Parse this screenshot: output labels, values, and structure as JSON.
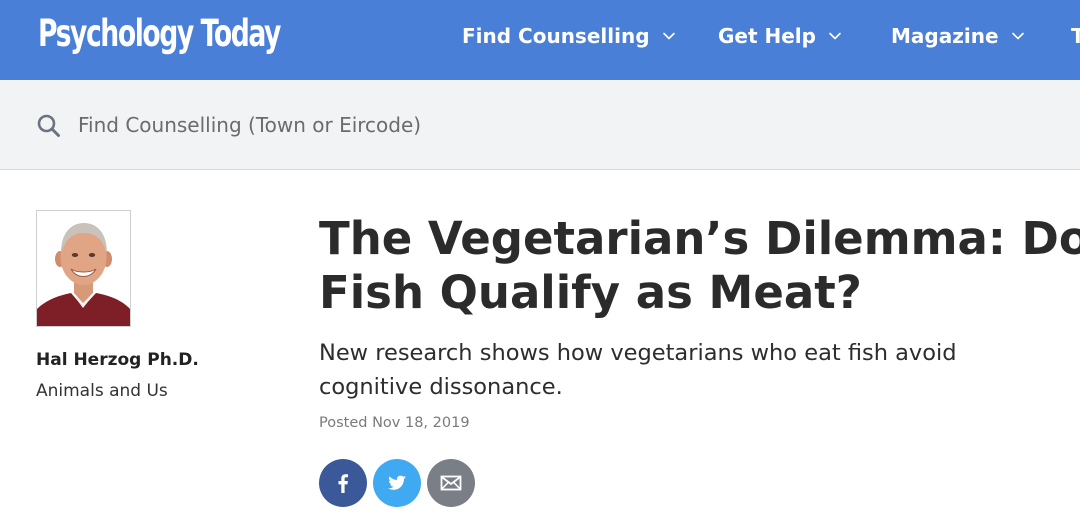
{
  "header": {
    "logo_text": "Psychology Today",
    "nav": [
      {
        "label": "Find Counselling",
        "has_dropdown": true
      },
      {
        "label": "Get Help",
        "has_dropdown": true
      },
      {
        "label": "Magazine",
        "has_dropdown": true
      },
      {
        "label": "T",
        "has_dropdown": false
      }
    ],
    "colors": {
      "bar": "#4a7fd8",
      "text": "#ffffff"
    }
  },
  "search": {
    "placeholder": "Find Counselling (Town or Eircode)",
    "value": "",
    "icon": "search-icon"
  },
  "author": {
    "name": "Hal Herzog Ph.D.",
    "blog": "Animals and Us",
    "photo_icon": "author-photo"
  },
  "article": {
    "title_lines": [
      "The Vegetarian’s Dilemma: Do",
      "Fish Qualify as Meat?"
    ],
    "subtitle_lines": [
      "New research shows how vegetarians who eat fish avoid",
      "cognitive dissonance."
    ],
    "posted": "Posted Nov 18, 2019"
  },
  "share": [
    {
      "icon": "facebook-icon",
      "color": "#3b5998"
    },
    {
      "icon": "twitter-icon",
      "color": "#3fa9f1"
    },
    {
      "icon": "email-icon",
      "color": "#7a7f87"
    }
  ]
}
